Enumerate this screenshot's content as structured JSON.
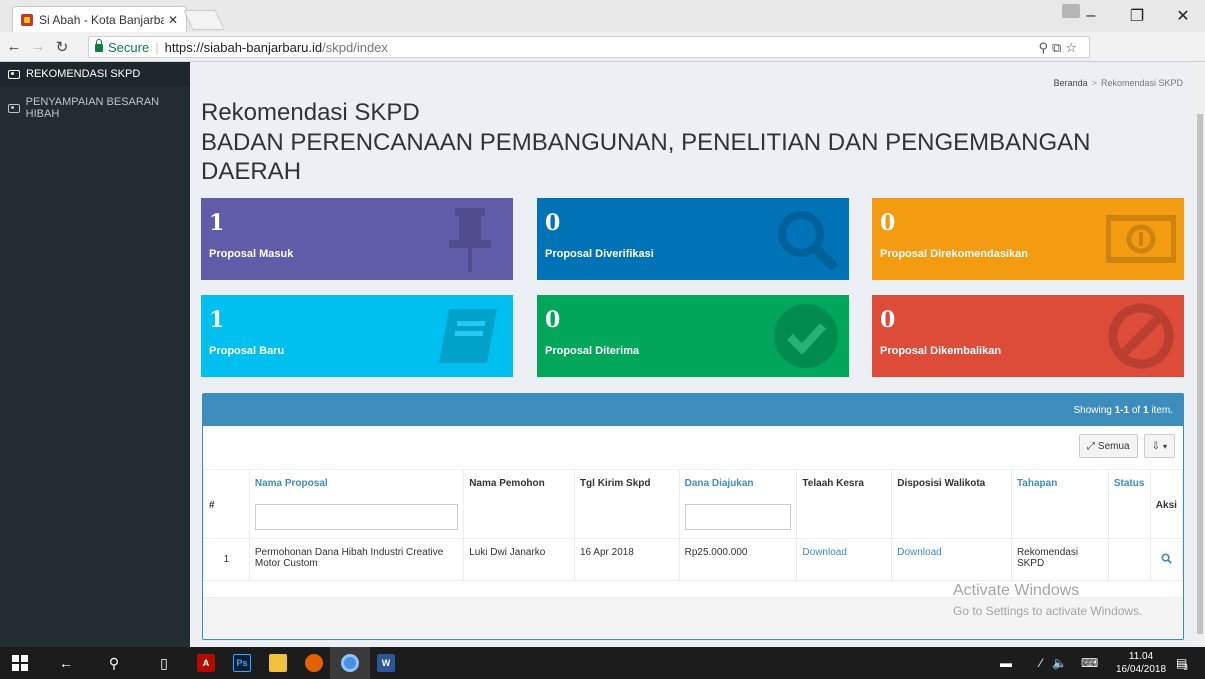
{
  "browser": {
    "tab_title": "Si Abah - Kota Banjarbar",
    "tab_close": "✕",
    "secure_label": "Secure",
    "url_host": "https://siabah-banjarbaru.id",
    "url_path": "/skpd/index",
    "extensions": [
      "M",
      "I"
    ]
  },
  "sidebar": {
    "items": [
      {
        "label": "REKOMENDASI SKPD",
        "active": true
      },
      {
        "label": "PENYAMPAIAN BESARAN HIBAH",
        "active": false
      }
    ]
  },
  "breadcrumb": {
    "home": "Beranda",
    "separator": ">",
    "current": "Rekomendasi SKPD"
  },
  "page": {
    "title": "Rekomendasi SKPD",
    "subtitle": "BADAN PERENCANAAN PEMBANGUNAN, PENELITIAN DAN PENGEMBANGAN DAERAH"
  },
  "stats": [
    {
      "value": "1",
      "label": "Proposal Masuk",
      "color": "#605ca8",
      "icon": "pushpin-icon"
    },
    {
      "value": "0",
      "label": "Proposal Diverifikasi",
      "color": "#0073b7",
      "icon": "search-icon"
    },
    {
      "value": "0",
      "label": "Proposal Direkomendasikan",
      "color": "#f39c12",
      "icon": "money-icon"
    },
    {
      "value": "1",
      "label": "Proposal Baru",
      "color": "#00c0ef",
      "icon": "book-icon"
    },
    {
      "value": "0",
      "label": "Proposal Diterima",
      "color": "#00a65a",
      "icon": "check-circle-icon"
    },
    {
      "value": "0",
      "label": "Proposal Dikembalikan",
      "color": "#dd4b39",
      "icon": "ban-icon"
    }
  ],
  "grid": {
    "summary_prefix": "Showing",
    "summary_range": "1-1",
    "summary_mid": "of",
    "summary_total": "1",
    "summary_suffix": "item.",
    "toggle_label": "Semua",
    "columns": {
      "hash": "#",
      "nama_proposal": "Nama Proposal",
      "nama_pemohon": "Nama Pemohon",
      "tgl_kirim": "Tgl Kirim Skpd",
      "dana_diajukan": "Dana Diajukan",
      "telaah_kesra": "Telaah Kesra",
      "disposisi": "Disposisi Walikota",
      "tahapan": "Tahapan",
      "status": "Status",
      "aksi": "Aksi"
    },
    "rows": [
      {
        "no": "1",
        "nama_proposal": "Permohonan Dana Hibah Industri Creative Motor Custom",
        "nama_pemohon": "Luki Dwi Janarko",
        "tgl_kirim": "16 Apr 2018",
        "dana_diajukan": "Rp25.000.000",
        "telaah_kesra": "Download",
        "disposisi": "Download",
        "tahapan": "Rekomendasi SKPD",
        "status": ""
      }
    ]
  },
  "watermark": {
    "line1": "Activate Windows",
    "line2": "Go to Settings to activate Windows."
  },
  "taskbar": {
    "time": "11.04",
    "date": "16/04/2018",
    "notification_count": "3"
  }
}
